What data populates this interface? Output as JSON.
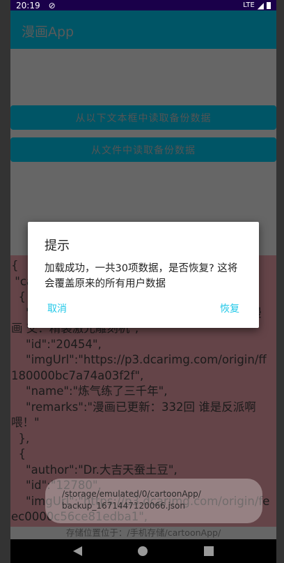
{
  "status_bar": {
    "time": "20:19",
    "network": "LTE"
  },
  "app_bar": {
    "title": "漫画App"
  },
  "buttons": {
    "read_from_text": "从以下文本框中读取备份数据",
    "read_from_file": "从文件中读取备份数据"
  },
  "json_text": "{\n \"ca\n  {\n    \"                                                            漫\n画 交：精装激光雕刻机\",\n    \"id\":\"20454\",\n    \"imgUrl\":\"https://p3.dcarimg.com/origin/ff180000bc7a74a03f2f\",\n    \"name\":\"炼气练了三千年\",\n    \"remarks\":\"漫画已更新：332回 谁是反派啊喂！\"\n  },\n  {\n    \"author\":\"Dr.大吉天蚕土豆\",\n    \"id\":\"12780\",\n    \"imgUrl\":\"https://p3.dcarimg.com/origin/feec0000c56ce81edba1\",",
  "footer": "存储位置位于：/手机存储/cartoonApp/",
  "dialog": {
    "title": "提示",
    "message": "加载成功，一共30项数据，是否恢复? 这将会覆盖原来的所有用户数据",
    "cancel": "取消",
    "confirm": "恢复"
  },
  "toast": {
    "line1": "/storage/emulated/0/cartoonApp/",
    "line2": "backup_1671447120066.json"
  }
}
